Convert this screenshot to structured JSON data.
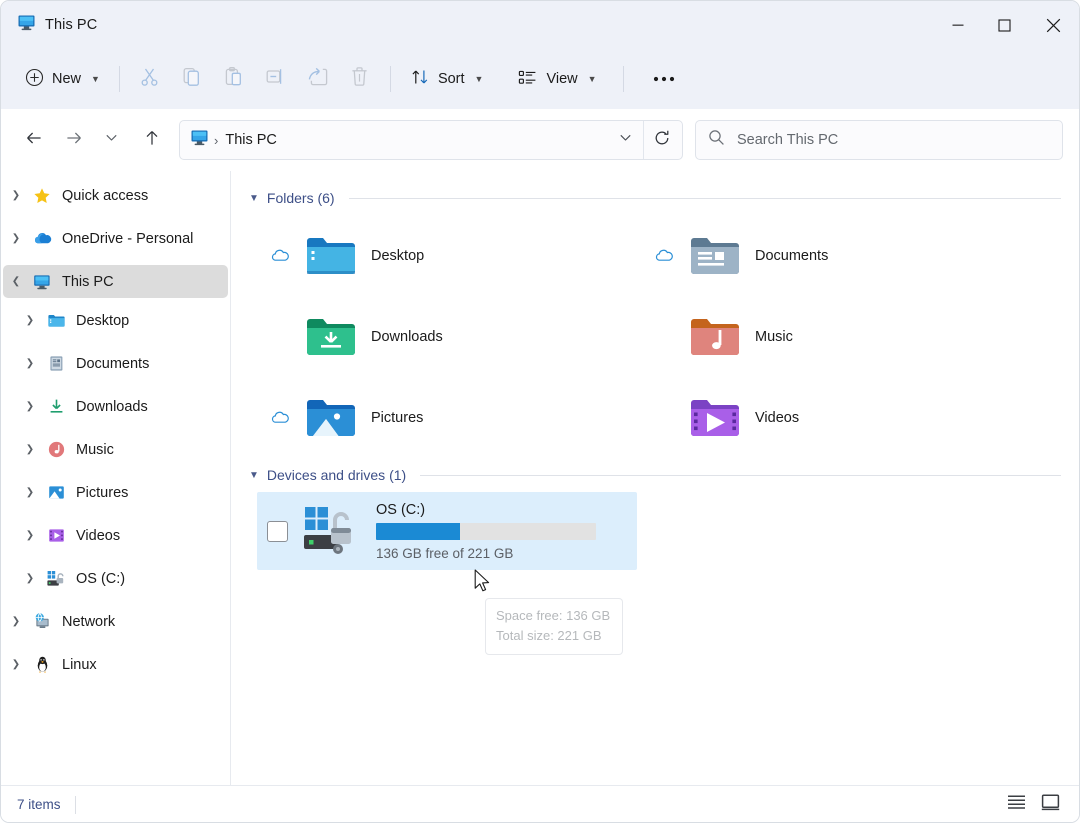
{
  "window": {
    "title": "This PC",
    "title_icon": "monitor-icon",
    "controls": {
      "minimize": "minimize-icon",
      "maximize": "maximize-icon",
      "close": "close-icon"
    }
  },
  "toolbar": {
    "new_label": "New",
    "new_icon": "plus-circle-icon",
    "items": [
      {
        "name": "cut",
        "icon": "scissors-icon",
        "disabled": true
      },
      {
        "name": "copy",
        "icon": "copy-icon",
        "disabled": true
      },
      {
        "name": "paste",
        "icon": "clipboard-icon",
        "disabled": true
      },
      {
        "name": "rename",
        "icon": "rename-icon",
        "disabled": true
      },
      {
        "name": "share",
        "icon": "share-icon",
        "disabled": true
      },
      {
        "name": "delete",
        "icon": "trash-icon",
        "disabled": true
      }
    ],
    "sort_label": "Sort",
    "sort_icon": "sort-arrows-icon",
    "view_label": "View",
    "view_icon": "view-list-icon",
    "more_label": "...",
    "more_icon": "ellipsis-icon"
  },
  "address": {
    "back_icon": "arrow-left-icon",
    "forward_icon": "arrow-right-icon",
    "recent_icon": "chevron-down-icon",
    "up_icon": "arrow-up-icon",
    "crumb_icon": "monitor-icon",
    "crumb_separator": "›",
    "crumb_text": "This PC",
    "dropdown_icon": "chevron-down-icon",
    "refresh_icon": "refresh-icon",
    "search_icon": "search-icon",
    "search_placeholder": "Search This PC",
    "search_value": ""
  },
  "sidebar": {
    "items": [
      {
        "label": "Quick access",
        "icon": "star-icon",
        "level": 1,
        "expanded": false,
        "selected": false
      },
      {
        "label": "OneDrive - Personal",
        "icon": "cloud-icon",
        "level": 1,
        "expanded": false,
        "selected": false
      },
      {
        "label": "This PC",
        "icon": "monitor-icon",
        "level": 1,
        "expanded": true,
        "selected": true
      },
      {
        "label": "Desktop",
        "icon": "desktop-folder-icon",
        "level": 2,
        "expanded": false,
        "selected": false
      },
      {
        "label": "Documents",
        "icon": "documents-folder-icon",
        "level": 2,
        "expanded": false,
        "selected": false
      },
      {
        "label": "Downloads",
        "icon": "downloads-icon",
        "level": 2,
        "expanded": false,
        "selected": false
      },
      {
        "label": "Music",
        "icon": "music-folder-icon",
        "level": 2,
        "expanded": false,
        "selected": false
      },
      {
        "label": "Pictures",
        "icon": "pictures-folder-icon",
        "level": 2,
        "expanded": false,
        "selected": false
      },
      {
        "label": "Videos",
        "icon": "videos-folder-icon",
        "level": 2,
        "expanded": false,
        "selected": false
      },
      {
        "label": "OS (C:)",
        "icon": "drive-icon",
        "level": 2,
        "expanded": false,
        "selected": false
      },
      {
        "label": "Network",
        "icon": "network-icon",
        "level": 1,
        "expanded": false,
        "selected": false
      },
      {
        "label": "Linux",
        "icon": "penguin-icon",
        "level": 1,
        "expanded": false,
        "selected": false
      }
    ]
  },
  "content": {
    "folders_group": {
      "title": "Folders (6)",
      "collapse_icon": "chevron-down-icon",
      "items": [
        {
          "label": "Desktop",
          "icon": "desktop-folder-icon",
          "cloud": true
        },
        {
          "label": "Documents",
          "icon": "documents-folder-icon",
          "cloud": true
        },
        {
          "label": "Downloads",
          "icon": "downloads-folder-icon",
          "cloud": false
        },
        {
          "label": "Music",
          "icon": "music-folder-icon",
          "cloud": false
        },
        {
          "label": "Pictures",
          "icon": "pictures-folder-icon",
          "cloud": true
        },
        {
          "label": "Videos",
          "icon": "videos-folder-icon",
          "cloud": false
        }
      ]
    },
    "drives_group": {
      "title": "Devices and drives (1)",
      "collapse_icon": "chevron-down-icon",
      "items": [
        {
          "label": "OS (C:)",
          "icon": "windows-drive-unlocked-icon",
          "capacity_text": "136 GB free of 221 GB",
          "used_percent": 38,
          "checked": false
        }
      ]
    },
    "tooltip": {
      "line1": "Space free: 136 GB",
      "line2": "Total size: 221 GB"
    }
  },
  "statusbar": {
    "item_count": "7 items",
    "details_view_icon": "details-view-icon",
    "large_icons_view_icon": "large-icons-view-icon"
  },
  "colors": {
    "chrome": "#eef1f8",
    "accent_blue": "#1b8ad4",
    "group_header": "#3d4f87",
    "selection": "#dceefc",
    "nav_selection": "#dcdcdc"
  }
}
